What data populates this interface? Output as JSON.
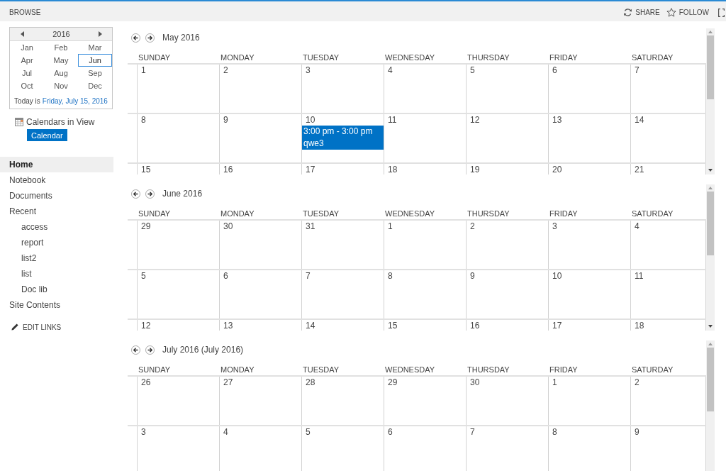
{
  "top_bar": {
    "tab": "BROWSE",
    "share": "SHARE",
    "follow": "FOLLOW"
  },
  "date_picker": {
    "year": "2016",
    "months": [
      {
        "label": "Jan",
        "selected": false
      },
      {
        "label": "Feb",
        "selected": false
      },
      {
        "label": "Mar",
        "selected": false
      },
      {
        "label": "Apr",
        "selected": false
      },
      {
        "label": "May",
        "selected": false
      },
      {
        "label": "Jun",
        "selected": true
      },
      {
        "label": "Jul",
        "selected": false
      },
      {
        "label": "Aug",
        "selected": false
      },
      {
        "label": "Sep",
        "selected": false
      },
      {
        "label": "Oct",
        "selected": false
      },
      {
        "label": "Nov",
        "selected": false
      },
      {
        "label": "Dec",
        "selected": false
      }
    ],
    "today_label": "Today is",
    "today_link": "Friday, July 15, 2016"
  },
  "calendars_in_view": {
    "label": "Calendars in View",
    "calendars": [
      {
        "label": "Calendar"
      }
    ]
  },
  "quick_launch": {
    "items": [
      {
        "label": "Home",
        "selected": true
      },
      {
        "label": "Notebook",
        "selected": false
      },
      {
        "label": "Documents",
        "selected": false
      },
      {
        "label": "Recent",
        "selected": false,
        "children": [
          {
            "label": "access",
            "selected": false
          },
          {
            "label": "report",
            "selected": false
          },
          {
            "label": "list2",
            "selected": false
          },
          {
            "label": "list",
            "selected": false
          },
          {
            "label": "Doc lib",
            "selected": false
          }
        ]
      },
      {
        "label": "Site Contents",
        "selected": false
      }
    ],
    "edit_links": "EDIT LINKS"
  },
  "months": [
    {
      "title": "May 2016",
      "weekdays": [
        "SUNDAY",
        "MONDAY",
        "TUESDAY",
        "WEDNESDAY",
        "THURSDAY",
        "FRIDAY",
        "SATURDAY"
      ],
      "weeks": [
        [
          {
            "day": "1"
          },
          {
            "day": "2"
          },
          {
            "day": "3"
          },
          {
            "day": "4"
          },
          {
            "day": "5"
          },
          {
            "day": "6"
          },
          {
            "day": "7"
          }
        ],
        [
          {
            "day": "8"
          },
          {
            "day": "9"
          },
          {
            "day": "10",
            "events": [
              {
                "time": "3:00 pm - 3:00 pm",
                "title": "qwe3"
              }
            ]
          },
          {
            "day": "11"
          },
          {
            "day": "12"
          },
          {
            "day": "13"
          },
          {
            "day": "14"
          }
        ],
        [
          {
            "day": "15"
          },
          {
            "day": "16"
          },
          {
            "day": "17"
          },
          {
            "day": "18"
          },
          {
            "day": "19"
          },
          {
            "day": "20"
          },
          {
            "day": "21"
          }
        ]
      ]
    },
    {
      "title": "June 2016",
      "weekdays": [
        "SUNDAY",
        "MONDAY",
        "TUESDAY",
        "WEDNESDAY",
        "THURSDAY",
        "FRIDAY",
        "SATURDAY"
      ],
      "weeks": [
        [
          {
            "day": "29"
          },
          {
            "day": "30"
          },
          {
            "day": "31"
          },
          {
            "day": "1"
          },
          {
            "day": "2"
          },
          {
            "day": "3"
          },
          {
            "day": "4"
          }
        ],
        [
          {
            "day": "5"
          },
          {
            "day": "6"
          },
          {
            "day": "7"
          },
          {
            "day": "8"
          },
          {
            "day": "9"
          },
          {
            "day": "10"
          },
          {
            "day": "11"
          }
        ],
        [
          {
            "day": "12"
          },
          {
            "day": "13"
          },
          {
            "day": "14"
          },
          {
            "day": "15"
          },
          {
            "day": "16"
          },
          {
            "day": "17"
          },
          {
            "day": "18"
          }
        ]
      ]
    },
    {
      "title": "July 2016 (July 2016)",
      "weekdays": [
        "SUNDAY",
        "MONDAY",
        "TUESDAY",
        "WEDNESDAY",
        "THURSDAY",
        "FRIDAY",
        "SATURDAY"
      ],
      "weeks": [
        [
          {
            "day": "26"
          },
          {
            "day": "27"
          },
          {
            "day": "28"
          },
          {
            "day": "29"
          },
          {
            "day": "30"
          },
          {
            "day": "1"
          },
          {
            "day": "2"
          }
        ],
        [
          {
            "day": "3"
          },
          {
            "day": "4"
          },
          {
            "day": "5"
          },
          {
            "day": "6"
          },
          {
            "day": "7"
          },
          {
            "day": "8"
          },
          {
            "day": "9"
          }
        ]
      ]
    }
  ]
}
